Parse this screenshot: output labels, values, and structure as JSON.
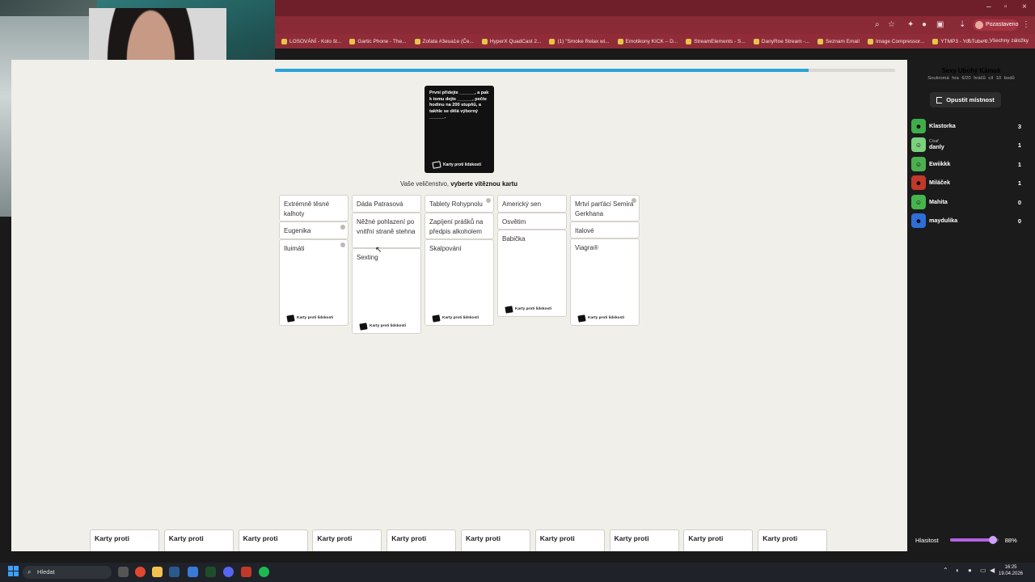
{
  "window": {
    "title_buttons": [
      "–",
      "▫",
      "×"
    ]
  },
  "browser": {
    "profile_label": "Pozastaveno",
    "bookmarks": [
      "LOSOVÁNÍ - Kolo št...",
      "Gartic Phone - The...",
      "Zoľata #3eua1e (Če...",
      "HyperX QuadCast 2...",
      "(1) \"Smoke Relax wi...",
      "Emotikony KICK – D...",
      "StreamElements - S...",
      "DanyRoe Stream -...",
      "Seznam Email",
      "Image Compressor...",
      "YTMP3 - YouTube t..."
    ],
    "bookmarks_overflow": "»",
    "all_bookmarks": "Všechny záložky"
  },
  "game": {
    "progress": 0.86,
    "black_card": {
      "text": "První přidejte ______, a pak k tomu dejte ______, pečte hodinu na 200 stupňů, a takhle se dělá výborný ______.",
      "brand": "Karty proti lidskosti"
    },
    "prompt_prefix": "Vaše veličenstvo,",
    "prompt_bold": "vyberte vítěznou kartu",
    "submissions": [
      {
        "cards": [
          "Extrémně těsné kalhoty",
          "Eugenika",
          "Iluimáti"
        ],
        "brand": "Karty proti lidskosti"
      },
      {
        "cards": [
          "Dáda Patrasová",
          "Něžné pohlazení po vnitřní straně stehna",
          "Sexting"
        ],
        "brand": "Karty proti lidskosti"
      },
      {
        "cards": [
          "Tablety Rohypnolu",
          "Zapíjení prášků na předpis alkoholem",
          "Skalpování"
        ],
        "brand": "Karty proti lidskosti"
      },
      {
        "cards": [
          "Americký sen",
          "Osvětim",
          "Babička"
        ],
        "brand": "Karty proti lidskosti"
      },
      {
        "cards": [
          "Mrtví parťáci Semira Gerkhana",
          "Italové",
          "Viagra®"
        ],
        "brand": "Karty proti lidskosti"
      }
    ],
    "hand_label": "Karty proti",
    "hand_count": 10
  },
  "sidebar": {
    "room_name": "Sexy Ubohý Kámoš",
    "room_meta": "Soukromá hra   6/20 hráčů   cíl 10 bodů",
    "leave_label": "Opustit místnost",
    "players": [
      {
        "name": "Klastorka",
        "role": "",
        "score": "3",
        "color": "#3fae4a",
        "face": "☻"
      },
      {
        "name": "danly",
        "role": "Císař",
        "score": "1",
        "color": "#7bd17e",
        "face": "☺"
      },
      {
        "name": "Ewiikkk",
        "role": "",
        "score": "1",
        "color": "#4caf50",
        "face": "☺"
      },
      {
        "name": "Miláček",
        "role": "",
        "score": "1",
        "color": "#c0392b",
        "face": "☻"
      },
      {
        "name": "Mahita",
        "role": "",
        "score": "0",
        "color": "#47b54e",
        "face": "☺"
      },
      {
        "name": "maydulika",
        "role": "",
        "score": "0",
        "color": "#2e6fd8",
        "face": "☻"
      }
    ],
    "volume_label": "Hlasitost",
    "volume": 0.88,
    "volume_text": "88%"
  },
  "taskbar": {
    "search_placeholder": "Hledat",
    "time": "16:25",
    "date": "19.04.2026"
  }
}
